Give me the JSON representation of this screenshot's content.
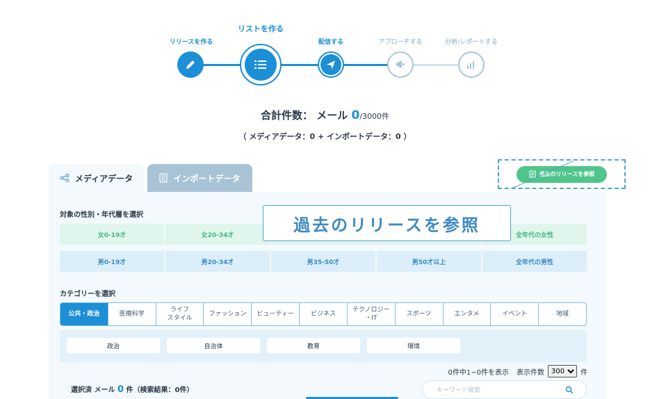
{
  "stepper": {
    "steps": [
      {
        "label": "リリースを作る",
        "state": "done",
        "icon": "pencil-icon"
      },
      {
        "label": "リストを作る",
        "state": "current",
        "icon": "list-icon"
      },
      {
        "label": "配信する",
        "state": "done",
        "icon": "paper-plane-icon"
      },
      {
        "label": "アプローチする",
        "state": "pending",
        "icon": "megaphone-icon"
      },
      {
        "label": "分析/レポートする",
        "state": "pending",
        "icon": "chart-icon"
      }
    ]
  },
  "totals": {
    "label": "合計件数：",
    "channel": "メール",
    "count": "0",
    "denominator": "/3000件",
    "breakdown": "（ メディアデータ：0 + インポートデータ：0 ）"
  },
  "tabs": {
    "media": "メディアデータ",
    "import": "インポートデータ"
  },
  "reference_button": "過去のリリースを参照",
  "callout_text": "過去のリリースを参照",
  "gender_section": {
    "title": "対象の性別・年代層を選択",
    "female": [
      "女0-19才",
      "女20-34才",
      "",
      "",
      "全年代の女性"
    ],
    "male": [
      "男0-19才",
      "男20-34才",
      "男35-50才",
      "男50才以上",
      "全年代の男性"
    ]
  },
  "category_section": {
    "title": "カテゴリーを選択",
    "items": [
      "公共・政治",
      "医療科学",
      "ライフ\nスタイル",
      "ファッション",
      "ビューティー",
      "ビジネス",
      "テクノロジー\n・IT",
      "スポーツ",
      "エンタメ",
      "イベント",
      "地域"
    ],
    "active_index": 0,
    "subcategories": [
      "政治",
      "自治体",
      "教育",
      "環境"
    ]
  },
  "pager": {
    "summary": "0件中1~0件を表示",
    "per_page_label": "表示件数",
    "per_page_value": "300",
    "unit": "件"
  },
  "selected": {
    "prefix": "選択済 メール",
    "count": "0",
    "suffix": "件（検索結果：0件）"
  },
  "search": {
    "placeholder": "キーワード検索"
  },
  "colors": {
    "accent": "#1c8fd6",
    "green": "#4fc58a",
    "pending": "#a9c6d8"
  }
}
